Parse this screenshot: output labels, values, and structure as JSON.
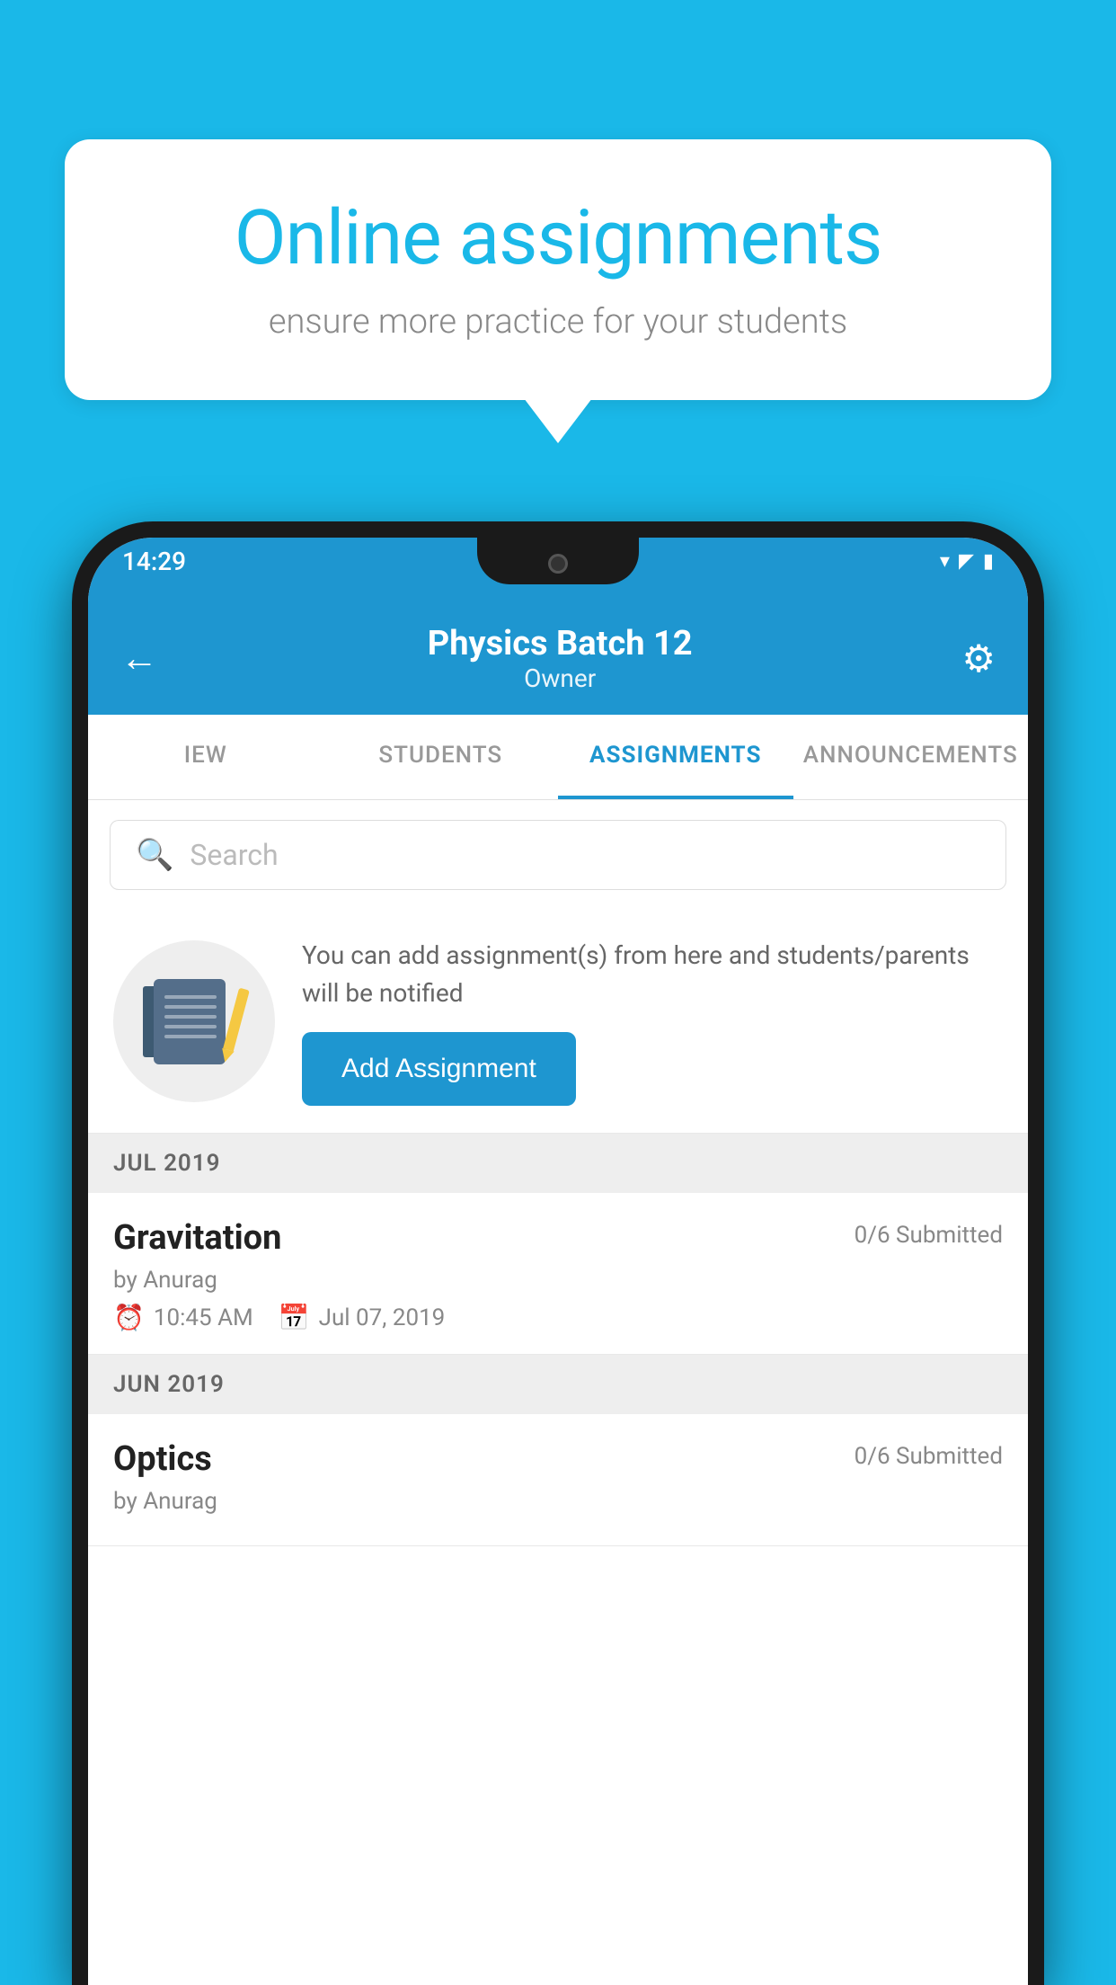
{
  "background_color": "#1ab8e8",
  "speech_bubble": {
    "title": "Online assignments",
    "subtitle": "ensure more practice for your students"
  },
  "status_bar": {
    "time": "14:29",
    "wifi_icon": "▾",
    "signal_icon": "▲",
    "battery_icon": "▮"
  },
  "header": {
    "title": "Physics Batch 12",
    "subtitle": "Owner",
    "back_label": "←",
    "settings_label": "⚙"
  },
  "tabs": [
    {
      "label": "IEW",
      "active": false
    },
    {
      "label": "STUDENTS",
      "active": false
    },
    {
      "label": "ASSIGNMENTS",
      "active": true
    },
    {
      "label": "ANNOUNCEMENTS",
      "active": false
    }
  ],
  "search": {
    "placeholder": "Search"
  },
  "add_assignment": {
    "description": "You can add assignment(s) from here and students/parents will be notified",
    "button_label": "Add Assignment"
  },
  "month_sections": [
    {
      "month": "JUL 2019",
      "assignments": [
        {
          "name": "Gravitation",
          "submitted": "0/6 Submitted",
          "by": "by Anurag",
          "time": "10:45 AM",
          "date": "Jul 07, 2019"
        }
      ]
    },
    {
      "month": "JUN 2019",
      "assignments": [
        {
          "name": "Optics",
          "submitted": "0/6 Submitted",
          "by": "by Anurag",
          "time": "",
          "date": ""
        }
      ]
    }
  ]
}
